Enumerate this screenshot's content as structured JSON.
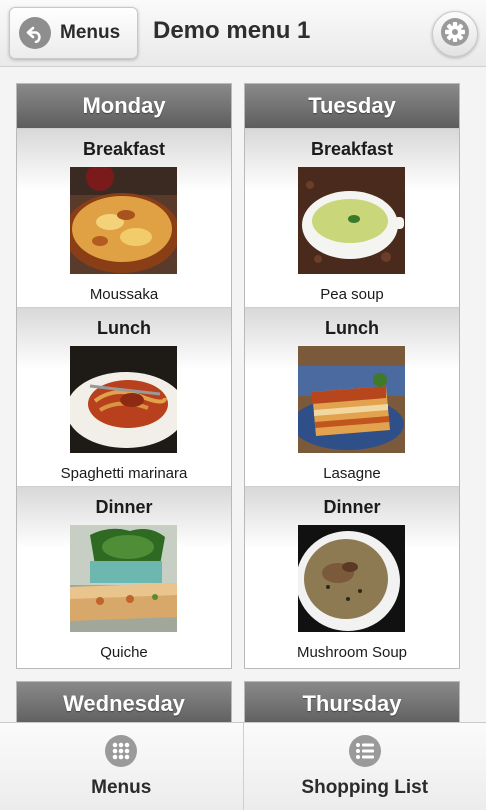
{
  "header": {
    "back_label": "Menus",
    "title": "Demo menu 1",
    "settings_icon": "gear-icon"
  },
  "days": [
    {
      "name": "Monday",
      "meals": [
        {
          "label": "Breakfast",
          "dish": "Moussaka",
          "photo": "moussaka"
        },
        {
          "label": "Lunch",
          "dish": "Spaghetti marinara",
          "photo": "spaghetti"
        },
        {
          "label": "Dinner",
          "dish": "Quiche",
          "photo": "quiche"
        }
      ]
    },
    {
      "name": "Tuesday",
      "meals": [
        {
          "label": "Breakfast",
          "dish": "Pea soup",
          "photo": "pea-soup"
        },
        {
          "label": "Lunch",
          "dish": "Lasagne",
          "photo": "lasagne"
        },
        {
          "label": "Dinner",
          "dish": "Mushroom Soup",
          "photo": "mushroom-soup"
        }
      ]
    },
    {
      "name": "Wednesday",
      "meals": []
    },
    {
      "name": "Thursday",
      "meals": []
    }
  ],
  "tabbar": {
    "tabs": [
      {
        "label": "Menus",
        "icon": "grid-icon"
      },
      {
        "label": "Shopping List",
        "icon": "list-icon"
      }
    ]
  }
}
